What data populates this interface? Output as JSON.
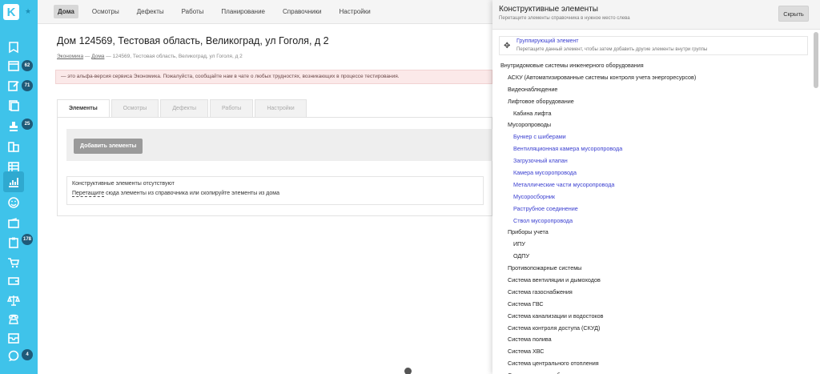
{
  "sidebar": {
    "logo": "K",
    "badges": [
      "62",
      "71",
      "25",
      "178",
      "4"
    ]
  },
  "topnav": {
    "tabs": [
      "Дома",
      "Осмотры",
      "Дефекты",
      "Работы",
      "Планирование",
      "Справочники",
      "Настройки"
    ]
  },
  "main": {
    "title": "Дом 124569, Тестовая область, Великоград, ул Гоголя, д 2",
    "breadcrumb": {
      "b1": "Экономика",
      "sep": "—",
      "b2": "Дома",
      "b3": "124569, Тестовая область, Великоград, ул Гоголя, д 2"
    },
    "alpha_notice": "— это альфа-версия сервиса Экономика. Пожалуйста, сообщайте нам в чате о любых трудностях, возникающих в процессе тестирования.",
    "tabs": [
      "Элементы",
      "Осмотры",
      "Дефекты",
      "Работы",
      "Настройки"
    ],
    "add_button": "Добавить элементы",
    "empty_line1": "Конструктивные элементы отсутствуют",
    "empty_drag": "Перетащите",
    "empty_rest": " сюда элементы из справочника или скопируйте элементы из дома"
  },
  "panel": {
    "title": "Конструктивные элементы",
    "subtitle": "Перетащите элементы справочника в нужное место слева",
    "hide_button": "Скрыть",
    "group_title": "Группирующий элемент",
    "group_subtitle": "Перетащите данный элемент, чтобы затем добавить другие элементы внутри группы",
    "tree": [
      {
        "level": 0,
        "label": "Внутридомовые системы инженерного оборудования"
      },
      {
        "level": 1,
        "label": "АСКУ (Автоматизированные системы контроля учета энергоресурсов)"
      },
      {
        "level": 1,
        "label": "Видеонаблюдение"
      },
      {
        "level": 1,
        "label": "Лифтовое оборудование"
      },
      {
        "level": 2,
        "label": "Кабина лифта"
      },
      {
        "level": 1,
        "label": "Мусоропроводы"
      },
      {
        "level": 2,
        "label": "Бункер с шиберами",
        "link": true
      },
      {
        "level": 2,
        "label": "Вентиляционная камера мусоропровода",
        "link": true
      },
      {
        "level": 2,
        "label": "Загрузочный клапан",
        "link": true
      },
      {
        "level": 2,
        "label": "Камера мусоропровода",
        "link": true
      },
      {
        "level": 2,
        "label": "Металлические части мусоропровода",
        "link": true
      },
      {
        "level": 2,
        "label": "Мусоросборник",
        "link": true
      },
      {
        "level": 2,
        "label": "Раструбное соединение",
        "link": true
      },
      {
        "level": 2,
        "label": "Ствол мусоропровода",
        "link": true
      },
      {
        "level": 1,
        "label": "Приборы учета"
      },
      {
        "level": 2,
        "label": "ИПУ"
      },
      {
        "level": 2,
        "label": "ОДПУ"
      },
      {
        "level": 1,
        "label": "Противопожарные системы"
      },
      {
        "level": 1,
        "label": "Система вентиляции и дымоходов"
      },
      {
        "level": 1,
        "label": "Система газоснабжения"
      },
      {
        "level": 1,
        "label": "Система ГВС"
      },
      {
        "level": 1,
        "label": "Система канализации и водостоков"
      },
      {
        "level": 1,
        "label": "Система контроля доступа (СКУД)"
      },
      {
        "level": 1,
        "label": "Система полива"
      },
      {
        "level": 1,
        "label": "Система ХВС"
      },
      {
        "level": 1,
        "label": "Система центрального отопления"
      },
      {
        "level": 1,
        "label": "Система электрооборудования"
      }
    ]
  }
}
